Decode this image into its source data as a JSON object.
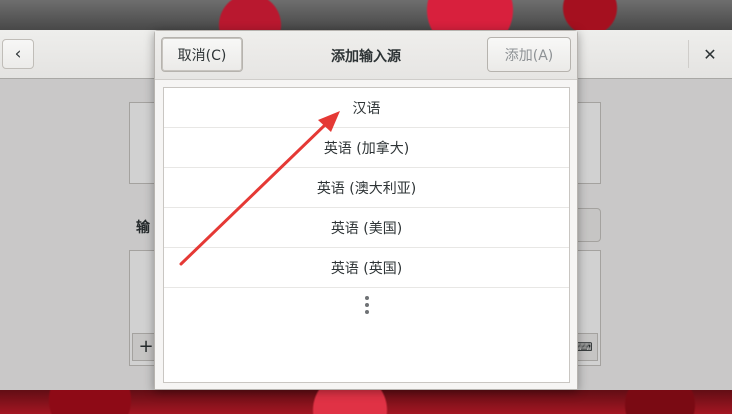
{
  "dialog": {
    "title": "添加输入源",
    "cancel_label": "取消(C)",
    "add_label": "添加(A)",
    "languages": [
      "汉语",
      "英语 (加拿大)",
      "英语 (澳大利亚)",
      "英语 (美国)",
      "英语 (英国)"
    ],
    "more_icon": "more-vertical-icon"
  },
  "settings": {
    "back_icon": "chevron-left-icon",
    "close_icon": "close-icon",
    "section_label_partial": "输",
    "add_icon": "plus-icon",
    "keyboard_icon": "keyboard-icon"
  },
  "colors": {
    "arrow": "#e53935",
    "dialog_bg": "#f6f5f4",
    "list_bg": "#ffffff"
  }
}
